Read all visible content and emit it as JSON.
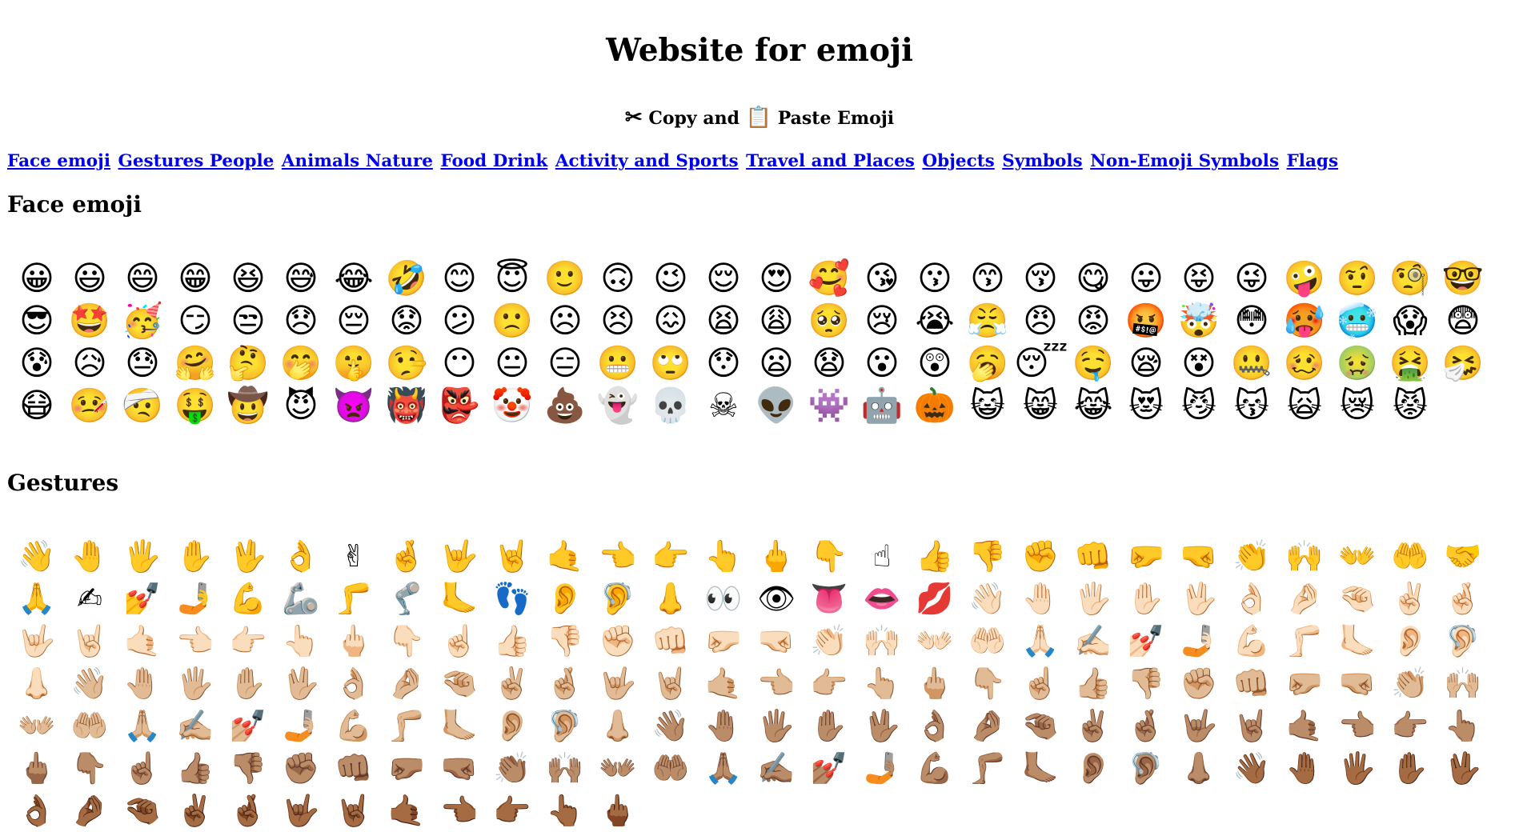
{
  "page": {
    "title": "Website for emoji",
    "subtitle": {
      "icon_left": "✂",
      "text_left": "Copy and",
      "icon_right": "📋",
      "text_right": "Paste Emoji"
    }
  },
  "nav": {
    "links": [
      "Face emoji",
      "Gestures People",
      "Animals Nature",
      "Food Drink",
      "Activity and Sports",
      "Travel and Places",
      "Objects",
      "Symbols",
      "Non-Emoji Symbols",
      "Flags"
    ]
  },
  "sections": {
    "faces": {
      "heading": "Face emoji",
      "emoji": [
        "😀",
        "😃",
        "😄",
        "😁",
        "😆",
        "😅",
        "😂",
        "🤣",
        "😊",
        "😇",
        "🙂",
        "🙃",
        "😉",
        "😌",
        "😍",
        "🥰",
        "😘",
        "😗",
        "😙",
        "😚",
        "😋",
        "😛",
        "😝",
        "😜",
        "🤪",
        "🤨",
        "🧐",
        "🤓",
        "😎",
        "🤩",
        "🥳",
        "😏",
        "😒",
        "😞",
        "😔",
        "😟",
        "😕",
        "🙁",
        "☹",
        "😣",
        "😖",
        "😫",
        "😩",
        "🥺",
        "😢",
        "😭",
        "😤",
        "😠",
        "😡",
        "🤬",
        "🤯",
        "😳",
        "🥵",
        "🥶",
        "😱",
        "😨",
        "😰",
        "😥",
        "😓",
        "🤗",
        "🤔",
        "🤭",
        "🤫",
        "🤥",
        "😶",
        "😐",
        "😑",
        "😬",
        "🙄",
        "😯",
        "😦",
        "😧",
        "😮",
        "😲",
        "🥱",
        "😴",
        "🤤",
        "😪",
        "😵",
        "🤐",
        "🥴",
        "🤢",
        "🤮",
        "🤧",
        "😷",
        "🤒",
        "🤕",
        "🤑",
        "🤠",
        "😈",
        "👿",
        "👹",
        "👺",
        "🤡",
        "💩",
        "👻",
        "💀",
        "☠",
        "👽",
        "👾",
        "🤖",
        "🎃",
        "😺",
        "😸",
        "😹",
        "😻",
        "😼",
        "😽",
        "🙀",
        "😿",
        "😾"
      ]
    },
    "gestures": {
      "heading": "Gestures",
      "emoji": [
        "👋",
        "🤚",
        "🖐",
        "✋",
        "🖖",
        "👌",
        "✌",
        "🤞",
        "🤟",
        "🤘",
        "🤙",
        "👈",
        "👉",
        "👆",
        "🖕",
        "👇",
        "☝",
        "👍",
        "👎",
        "✊",
        "👊",
        "🤛",
        "🤜",
        "👏",
        "🙌",
        "👐",
        "🤲",
        "🤝",
        "🙏",
        "✍",
        "💅",
        "🤳",
        "💪",
        "🦾",
        "🦵",
        "🦿",
        "🦶",
        "👣",
        "👂",
        "🦻",
        "👃",
        "👀",
        "👁",
        "👅",
        "👄",
        "💋",
        "👋🏻",
        "🤚🏻",
        "🖐🏻",
        "✋🏻",
        "🖖🏻",
        "👌🏻",
        "🤌🏻",
        "🤏🏻",
        "✌🏻",
        "🤞🏻",
        "🤟🏻",
        "🤘🏻",
        "🤙🏻",
        "👈🏻",
        "👉🏻",
        "👆🏻",
        "🖕🏻",
        "👇🏻",
        "☝🏻",
        "👍🏻",
        "👎🏻",
        "✊🏻",
        "👊🏻",
        "🤛🏻",
        "🤜🏻",
        "👏🏻",
        "🙌🏻",
        "👐🏻",
        "🤲🏻",
        "🙏🏻",
        "✍🏻",
        "💅🏻",
        "🤳🏻",
        "💪🏻",
        "🦵🏻",
        "🦶🏻",
        "👂🏻",
        "🦻🏻",
        "👃🏻",
        "👋🏼",
        "🤚🏼",
        "🖐🏼",
        "✋🏼",
        "🖖🏼",
        "👌🏼",
        "🤌🏼",
        "🤏🏼",
        "✌🏼",
        "🤞🏼",
        "🤟🏼",
        "🤘🏼",
        "🤙🏼",
        "👈🏼",
        "👉🏼",
        "👆🏼",
        "🖕🏼",
        "👇🏼",
        "☝🏼",
        "👍🏼",
        "👎🏼",
        "✊🏼",
        "👊🏼",
        "🤛🏼",
        "🤜🏼",
        "👏🏼",
        "🙌🏼",
        "👐🏼",
        "🤲🏼",
        "🙏🏼",
        "✍🏼",
        "💅🏼",
        "🤳🏼",
        "💪🏼",
        "🦵🏼",
        "🦶🏼",
        "👂🏼",
        "🦻🏼",
        "👃🏼",
        "👋🏽",
        "🤚🏽",
        "🖐🏽",
        "✋🏽",
        "🖖🏽",
        "👌🏽",
        "🤌🏽",
        "🤏🏽",
        "✌🏽",
        "🤞🏽",
        "🤟🏽",
        "🤘🏽",
        "🤙🏽",
        "👈🏽",
        "👉🏽",
        "👆🏽",
        "🖕🏽",
        "👇🏽",
        "☝🏽",
        "👍🏽",
        "👎🏽",
        "✊🏽",
        "👊🏽",
        "🤛🏽",
        "🤜🏽",
        "👏🏽",
        "🙌🏽",
        "👐🏽",
        "🤲🏽",
        "🙏🏽",
        "✍🏽",
        "💅🏽",
        "🤳🏽",
        "💪🏽",
        "🦵🏽",
        "🦶🏽",
        "👂🏽",
        "🦻🏽",
        "👃🏽",
        "👋🏾",
        "🤚🏾",
        "🖐🏾",
        "✋🏾",
        "🖖🏾",
        "👌🏾",
        "🤌🏾",
        "🤏🏾",
        "✌🏾",
        "🤞🏾",
        "🤟🏾",
        "🤘🏾",
        "🤙🏾",
        "👈🏾",
        "👉🏾",
        "👆🏾",
        "🖕🏾"
      ]
    }
  },
  "colors": {
    "link": "#0000ee",
    "text": "#000000",
    "background": "#ffffff"
  }
}
